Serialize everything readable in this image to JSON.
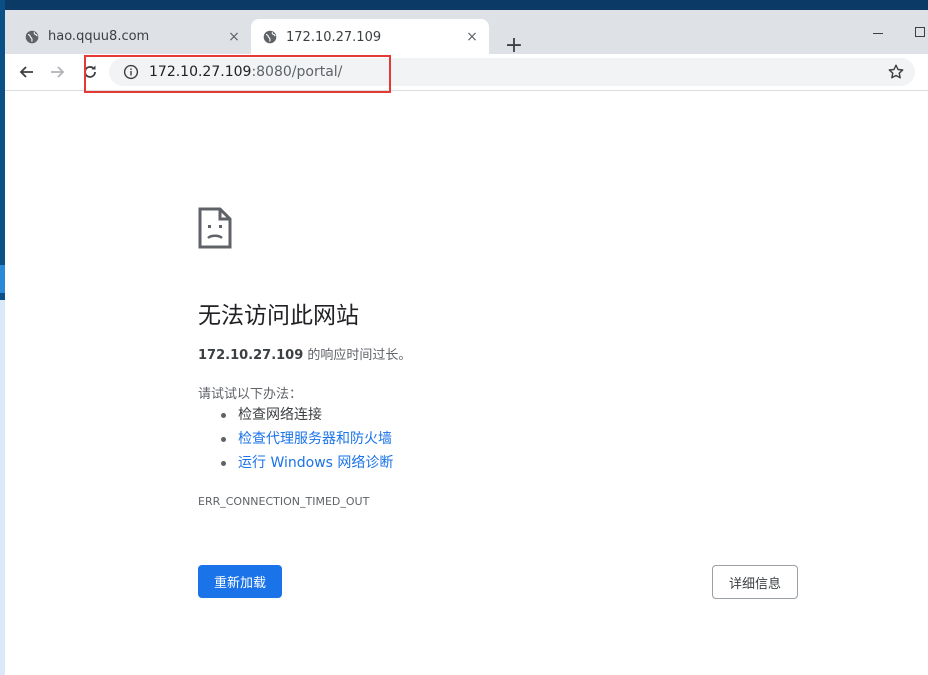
{
  "tabs": [
    {
      "title": "hao.qquu8.com",
      "active": false,
      "favicon": "globe-icon",
      "close": "×"
    },
    {
      "title": "172.10.27.109",
      "active": true,
      "favicon": "globe-icon",
      "close": "×"
    }
  ],
  "new_tab_label": "+",
  "toolbar": {
    "url_host": "172.10.27.109",
    "url_rest": ":8080/portal/",
    "icons": [
      "back-arrow-icon",
      "forward-arrow-icon",
      "reload-icon",
      "info-icon",
      "star-icon"
    ]
  },
  "error_page": {
    "title": "无法访问此网站",
    "host": "172.10.27.109",
    "desc_suffix": " 的响应时间过长。",
    "try_label": "请试试以下办法：",
    "suggestions": [
      "检查网络连接",
      "检查代理服务器和防火墙",
      "运行 Windows 网络诊断"
    ],
    "error_code": "ERR_CONNECTION_TIMED_OUT",
    "reload_label": "重新加载",
    "details_label": "详细信息"
  },
  "colors": {
    "accent": "#1a73e8",
    "highlight_border": "#e53935",
    "tabstrip_bg": "#dee1e6"
  }
}
